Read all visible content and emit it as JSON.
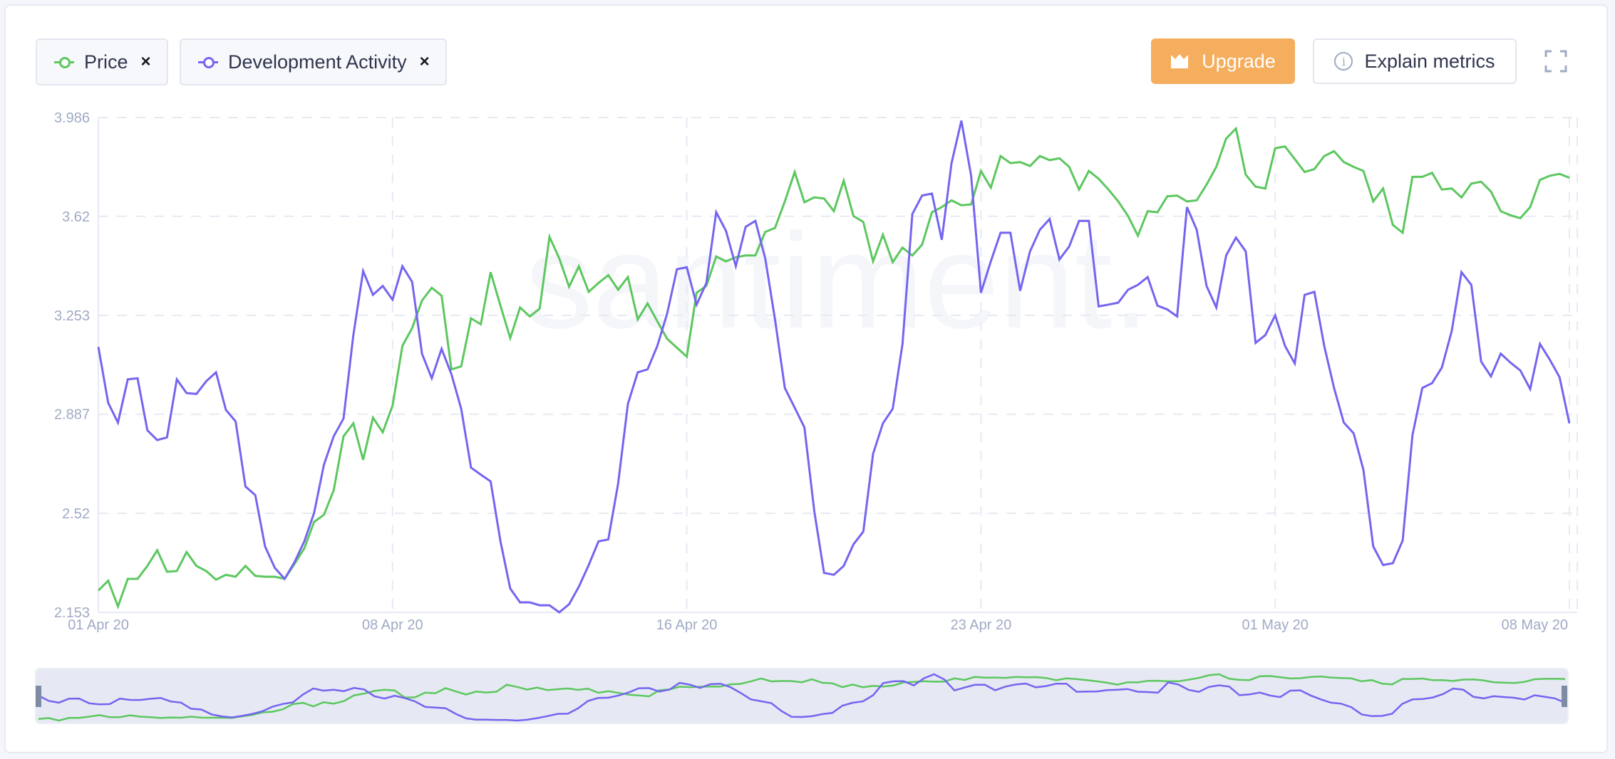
{
  "toolbar": {
    "metrics": [
      {
        "label": "Price",
        "color": "#5cc75f",
        "close": "×"
      },
      {
        "label": "Development Activity",
        "color": "#7465f0",
        "close": "×"
      }
    ],
    "upgrade_label": "Upgrade",
    "upgrade_icon": "crown-icon",
    "explain_label": "Explain metrics",
    "explain_icon": "info-icon",
    "fullscreen_icon": "fullscreen-icon"
  },
  "watermark": "santiment.",
  "colors": {
    "price": "#5cc75f",
    "dev": "#7465f0",
    "upgrade": "#f4ae5e",
    "axis_text": "#9faac4",
    "grid": "#e7eaf3",
    "navigator_bg": "#e6e9f3",
    "navigator_handle": "#7f8aa3"
  },
  "chart_data": {
    "type": "line",
    "title": "",
    "xlabel": "",
    "ylabel": "",
    "ylim": [
      2.153,
      3.986
    ],
    "y_ticks": [
      "3.986",
      "3.62",
      "3.253",
      "2.887",
      "2.52",
      "2.153"
    ],
    "y_tick_values": [
      3.986,
      3.62,
      3.253,
      2.887,
      2.52,
      2.153
    ],
    "x_ticks": [
      "01 Apr 20",
      "08 Apr 20",
      "16 Apr 20",
      "23 Apr 20",
      "01 May 20",
      "08 May 20"
    ],
    "x_tick_indices": [
      0,
      30,
      60,
      90,
      120,
      150
    ],
    "grid": true,
    "legend": "top-left",
    "points_count": 151,
    "series": [
      {
        "name": "Price",
        "color": "#5cc75f",
        "values": [
          2.234,
          2.27,
          2.175,
          2.277,
          2.277,
          2.325,
          2.383,
          2.303,
          2.306,
          2.376,
          2.325,
          2.306,
          2.274,
          2.292,
          2.285,
          2.325,
          2.288,
          2.285,
          2.285,
          2.277,
          2.332,
          2.39,
          2.488,
          2.514,
          2.605,
          2.805,
          2.853,
          2.718,
          2.874,
          2.82,
          2.918,
          3.14,
          3.206,
          3.308,
          3.355,
          3.326,
          3.053,
          3.064,
          3.242,
          3.22,
          3.413,
          3.289,
          3.169,
          3.282,
          3.249,
          3.278,
          3.544,
          3.464,
          3.359,
          3.435,
          3.34,
          3.373,
          3.402,
          3.348,
          3.395,
          3.238,
          3.297,
          3.231,
          3.166,
          3.133,
          3.1,
          3.337,
          3.362,
          3.471,
          3.453,
          3.468,
          3.475,
          3.475,
          3.562,
          3.577,
          3.675,
          3.784,
          3.672,
          3.69,
          3.686,
          3.639,
          3.752,
          3.621,
          3.599,
          3.453,
          3.552,
          3.45,
          3.504,
          3.475,
          3.515,
          3.635,
          3.654,
          3.679,
          3.661,
          3.664,
          3.788,
          3.726,
          3.843,
          3.817,
          3.821,
          3.806,
          3.843,
          3.828,
          3.835,
          3.803,
          3.719,
          3.788,
          3.759,
          3.719,
          3.675,
          3.621,
          3.548,
          3.639,
          3.635,
          3.694,
          3.697,
          3.675,
          3.679,
          3.737,
          3.803,
          3.908,
          3.945,
          3.774,
          3.73,
          3.723,
          3.872,
          3.879,
          3.832,
          3.784,
          3.795,
          3.843,
          3.861,
          3.821,
          3.803,
          3.788,
          3.675,
          3.723,
          3.588,
          3.559,
          3.766,
          3.766,
          3.781,
          3.719,
          3.723,
          3.69,
          3.741,
          3.748,
          3.712,
          3.639,
          3.624,
          3.613,
          3.654,
          3.755,
          3.77,
          3.777,
          3.763
        ]
      },
      {
        "name": "Development Activity",
        "color": "#7465f0",
        "values": [
          3.136,
          2.929,
          2.856,
          3.016,
          3.02,
          2.827,
          2.791,
          2.801,
          3.016,
          2.965,
          2.962,
          3.009,
          3.042,
          2.903,
          2.86,
          2.619,
          2.587,
          2.397,
          2.317,
          2.277,
          2.339,
          2.416,
          2.521,
          2.7,
          2.805,
          2.871,
          3.18,
          3.417,
          3.329,
          3.362,
          3.311,
          3.435,
          3.377,
          3.111,
          3.02,
          3.129,
          3.035,
          2.907,
          2.689,
          2.663,
          2.638,
          2.416,
          2.241,
          2.19,
          2.19,
          2.179,
          2.179,
          2.153,
          2.183,
          2.248,
          2.328,
          2.416,
          2.423,
          2.63,
          2.925,
          3.042,
          3.053,
          3.14,
          3.26,
          3.424,
          3.431,
          3.293,
          3.373,
          3.635,
          3.566,
          3.435,
          3.581,
          3.603,
          3.464,
          3.238,
          2.984,
          2.911,
          2.838,
          2.528,
          2.299,
          2.292,
          2.325,
          2.405,
          2.452,
          2.74,
          2.853,
          2.907,
          3.147,
          3.628,
          3.697,
          3.704,
          3.533,
          3.817,
          3.974,
          3.77,
          3.337,
          3.453,
          3.559,
          3.559,
          3.344,
          3.49,
          3.57,
          3.61,
          3.46,
          3.508,
          3.603,
          3.603,
          3.286,
          3.293,
          3.3,
          3.348,
          3.366,
          3.395,
          3.289,
          3.275,
          3.249,
          3.654,
          3.57,
          3.362,
          3.282,
          3.475,
          3.541,
          3.49,
          3.151,
          3.18,
          3.253,
          3.14,
          3.075,
          3.329,
          3.34,
          3.14,
          2.984,
          2.856,
          2.816,
          2.681,
          2.397,
          2.328,
          2.335,
          2.419,
          2.809,
          2.984,
          3.002,
          3.06,
          3.195,
          3.413,
          3.366,
          3.082,
          3.027,
          3.111,
          3.078,
          3.049,
          2.98,
          3.147,
          3.089,
          3.024,
          2.853
        ]
      }
    ]
  }
}
